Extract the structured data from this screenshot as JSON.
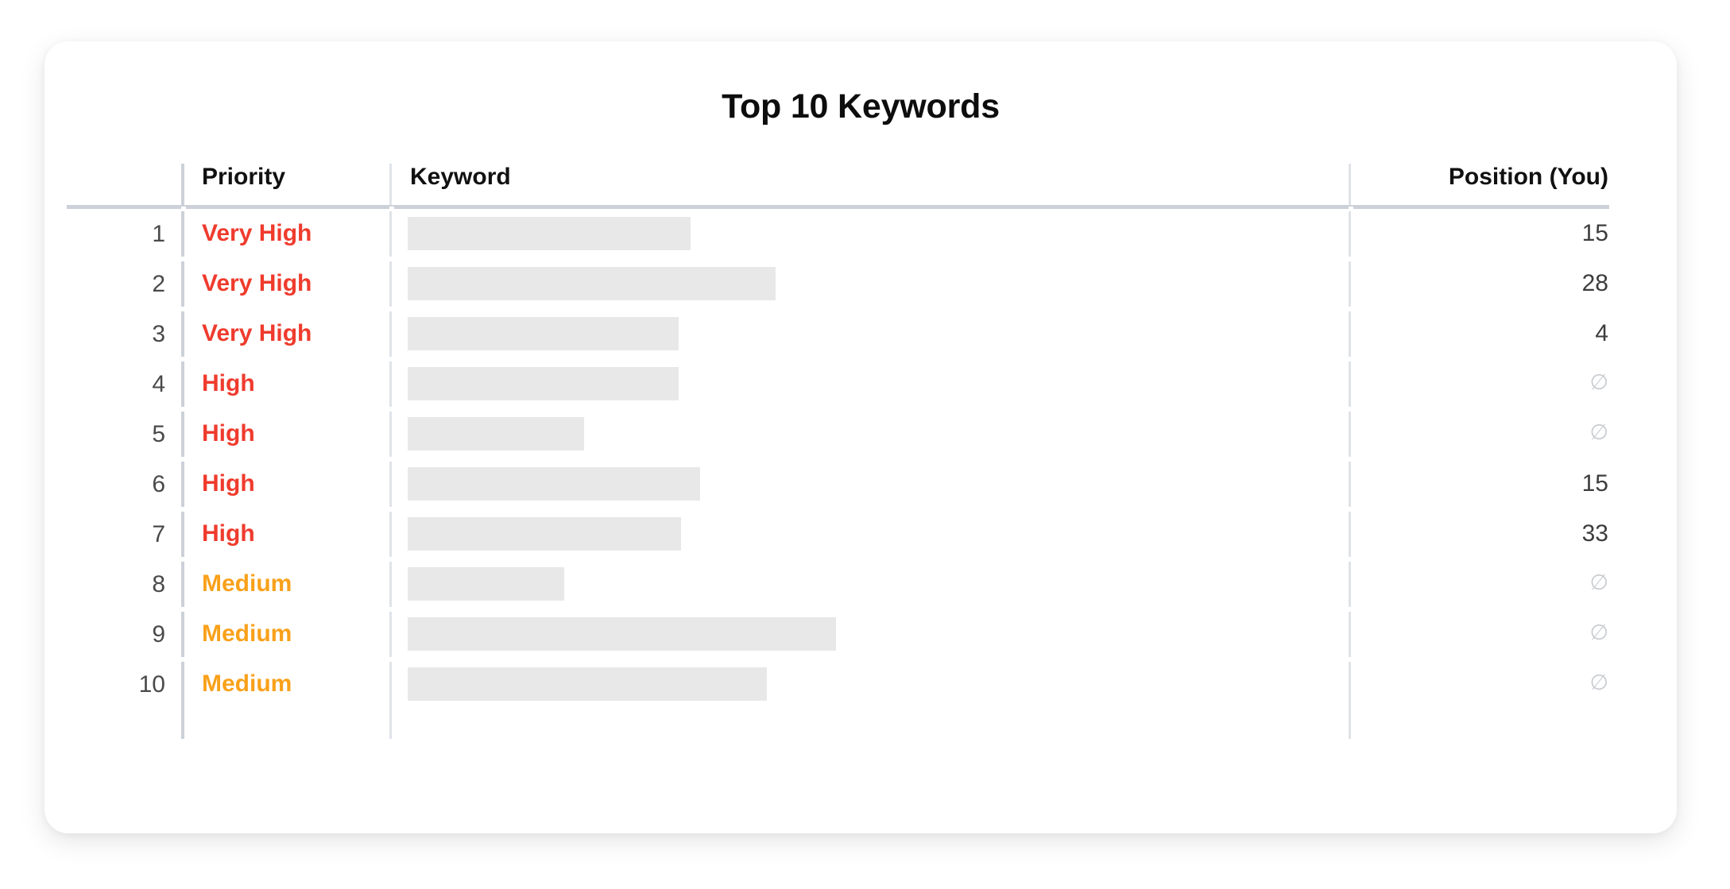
{
  "card": {
    "title": "Top 10 Keywords"
  },
  "table": {
    "headers": {
      "rank": "",
      "priority": "Priority",
      "keyword": "Keyword",
      "position": "Position (You)"
    },
    "rows": [
      {
        "rank": "1",
        "priority": "Very High",
        "priority_level": "veryhigh",
        "keyword_redacted_width": 356,
        "position": "15"
      },
      {
        "rank": "2",
        "priority": "Very High",
        "priority_level": "veryhigh",
        "keyword_redacted_width": 463,
        "position": "28"
      },
      {
        "rank": "3",
        "priority": "Very High",
        "priority_level": "veryhigh",
        "keyword_redacted_width": 341,
        "position": "4"
      },
      {
        "rank": "4",
        "priority": "High",
        "priority_level": "high",
        "keyword_redacted_width": 341,
        "position": "∅"
      },
      {
        "rank": "5",
        "priority": "High",
        "priority_level": "high",
        "keyword_redacted_width": 222,
        "position": "∅"
      },
      {
        "rank": "6",
        "priority": "High",
        "priority_level": "high",
        "keyword_redacted_width": 368,
        "position": "15"
      },
      {
        "rank": "7",
        "priority": "High",
        "priority_level": "high",
        "keyword_redacted_width": 344,
        "position": "33"
      },
      {
        "rank": "8",
        "priority": "Medium",
        "priority_level": "medium",
        "keyword_redacted_width": 197,
        "position": "∅"
      },
      {
        "rank": "9",
        "priority": "Medium",
        "priority_level": "medium",
        "keyword_redacted_width": 539,
        "position": "∅"
      },
      {
        "rank": "10",
        "priority": "Medium",
        "priority_level": "medium",
        "keyword_redacted_width": 452,
        "position": "∅"
      }
    ]
  },
  "colors": {
    "priority_very_high": "#ef3b2d",
    "priority_high": "#ef3b2d",
    "priority_medium": "#f9a11b",
    "redaction": "#e8e8e8",
    "rule": "#ccd1d9",
    "card_background": "#ffffff",
    "page_background": "#ffffff"
  }
}
